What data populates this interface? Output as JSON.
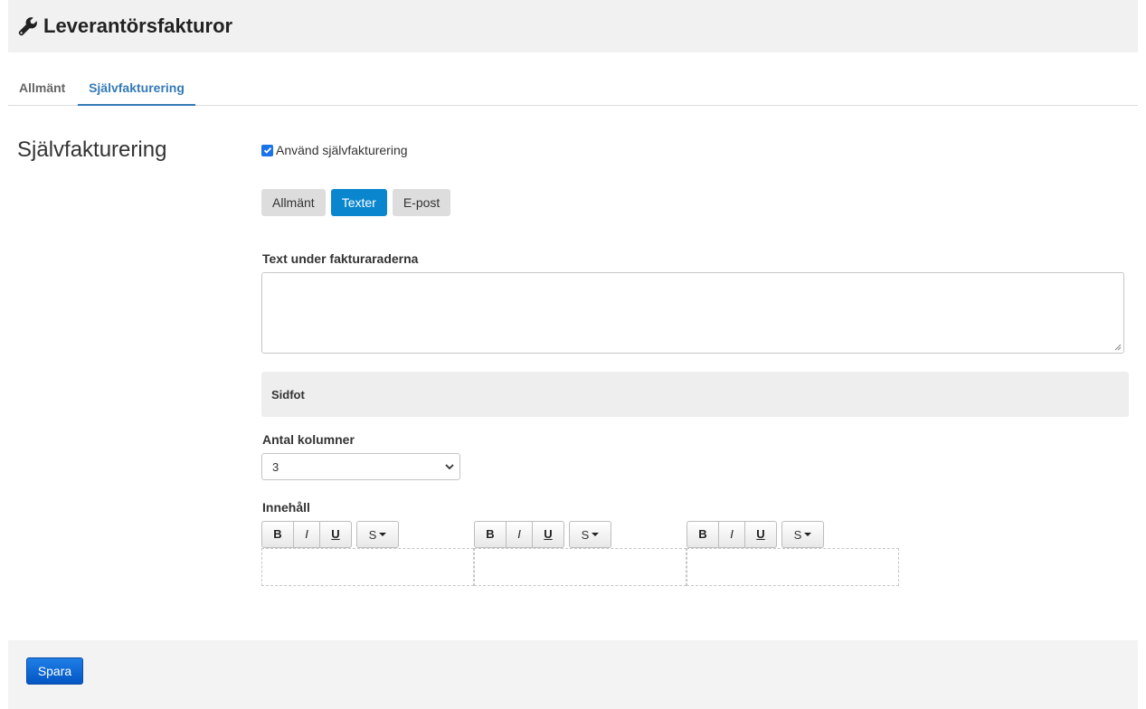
{
  "header": {
    "title": "Leverantörsfakturor",
    "icon": "wrench-icon"
  },
  "tabs": [
    {
      "label": "Allmänt",
      "active": false
    },
    {
      "label": "Självfakturering",
      "active": true
    }
  ],
  "section": {
    "title": "Självfakturering",
    "use_checkbox": {
      "label": "Använd självfakturering",
      "checked": true
    }
  },
  "subtabs": [
    {
      "label": "Allmänt",
      "active": false
    },
    {
      "label": "Texter",
      "active": true
    },
    {
      "label": "E-post",
      "active": false
    }
  ],
  "form": {
    "text_under_label": "Text under fakturaraderna",
    "text_under_value": "",
    "footer_heading": "Sidfot",
    "columns_label": "Antal kolumner",
    "columns_value": "3",
    "content_label": "Innehåll",
    "editor_buttons": {
      "bold": "B",
      "italic": "I",
      "underline": "U",
      "strike": "S"
    }
  },
  "actions": {
    "save_label": "Spara"
  },
  "colors": {
    "accent": "#337ab7",
    "active_subtab": "#0a86cf",
    "save_button": "#0356c4"
  }
}
